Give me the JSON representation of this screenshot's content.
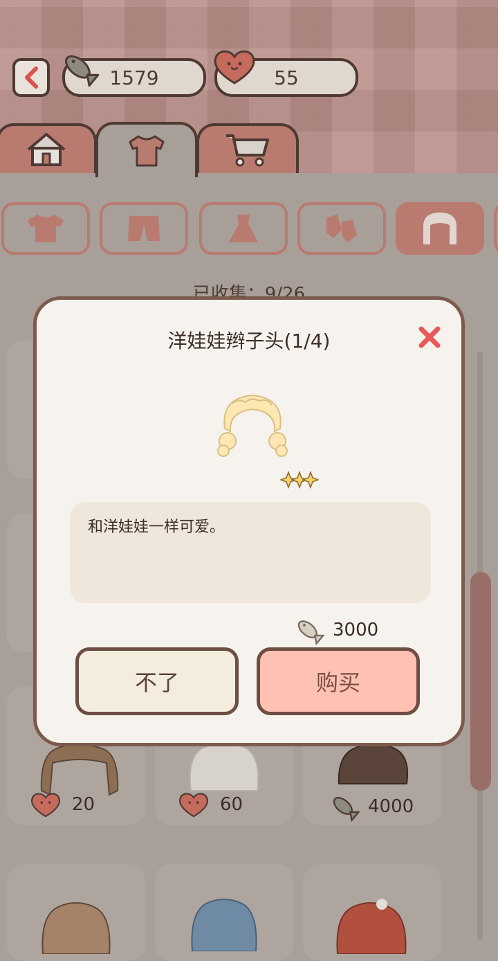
{
  "header": {
    "fish_count": "1579",
    "heart_count": "55"
  },
  "tabs": [
    {
      "icon": "house-icon"
    },
    {
      "icon": "shirt-icon"
    },
    {
      "icon": "cart-icon"
    }
  ],
  "categories": [
    {
      "icon": "shirt-icon"
    },
    {
      "icon": "shorts-icon"
    },
    {
      "icon": "dress-icon"
    },
    {
      "icon": "socks-icon"
    },
    {
      "icon": "hair-icon",
      "active": true
    }
  ],
  "collected_text": "已收集：9/26",
  "items": [
    {
      "price": "20",
      "currency": "heart"
    },
    {
      "price": "60",
      "currency": "heart"
    },
    {
      "price": "4000",
      "currency": "fish"
    }
  ],
  "modal": {
    "title": "洋娃娃辫子头(1/4)",
    "description": "和洋娃娃一样可爱。",
    "cost": "3000",
    "cancel_label": "不了",
    "buy_label": "购买"
  },
  "colors": {
    "accent": "#b97a70",
    "close": "#e9595a",
    "buy_button": "#ffc1b4"
  }
}
